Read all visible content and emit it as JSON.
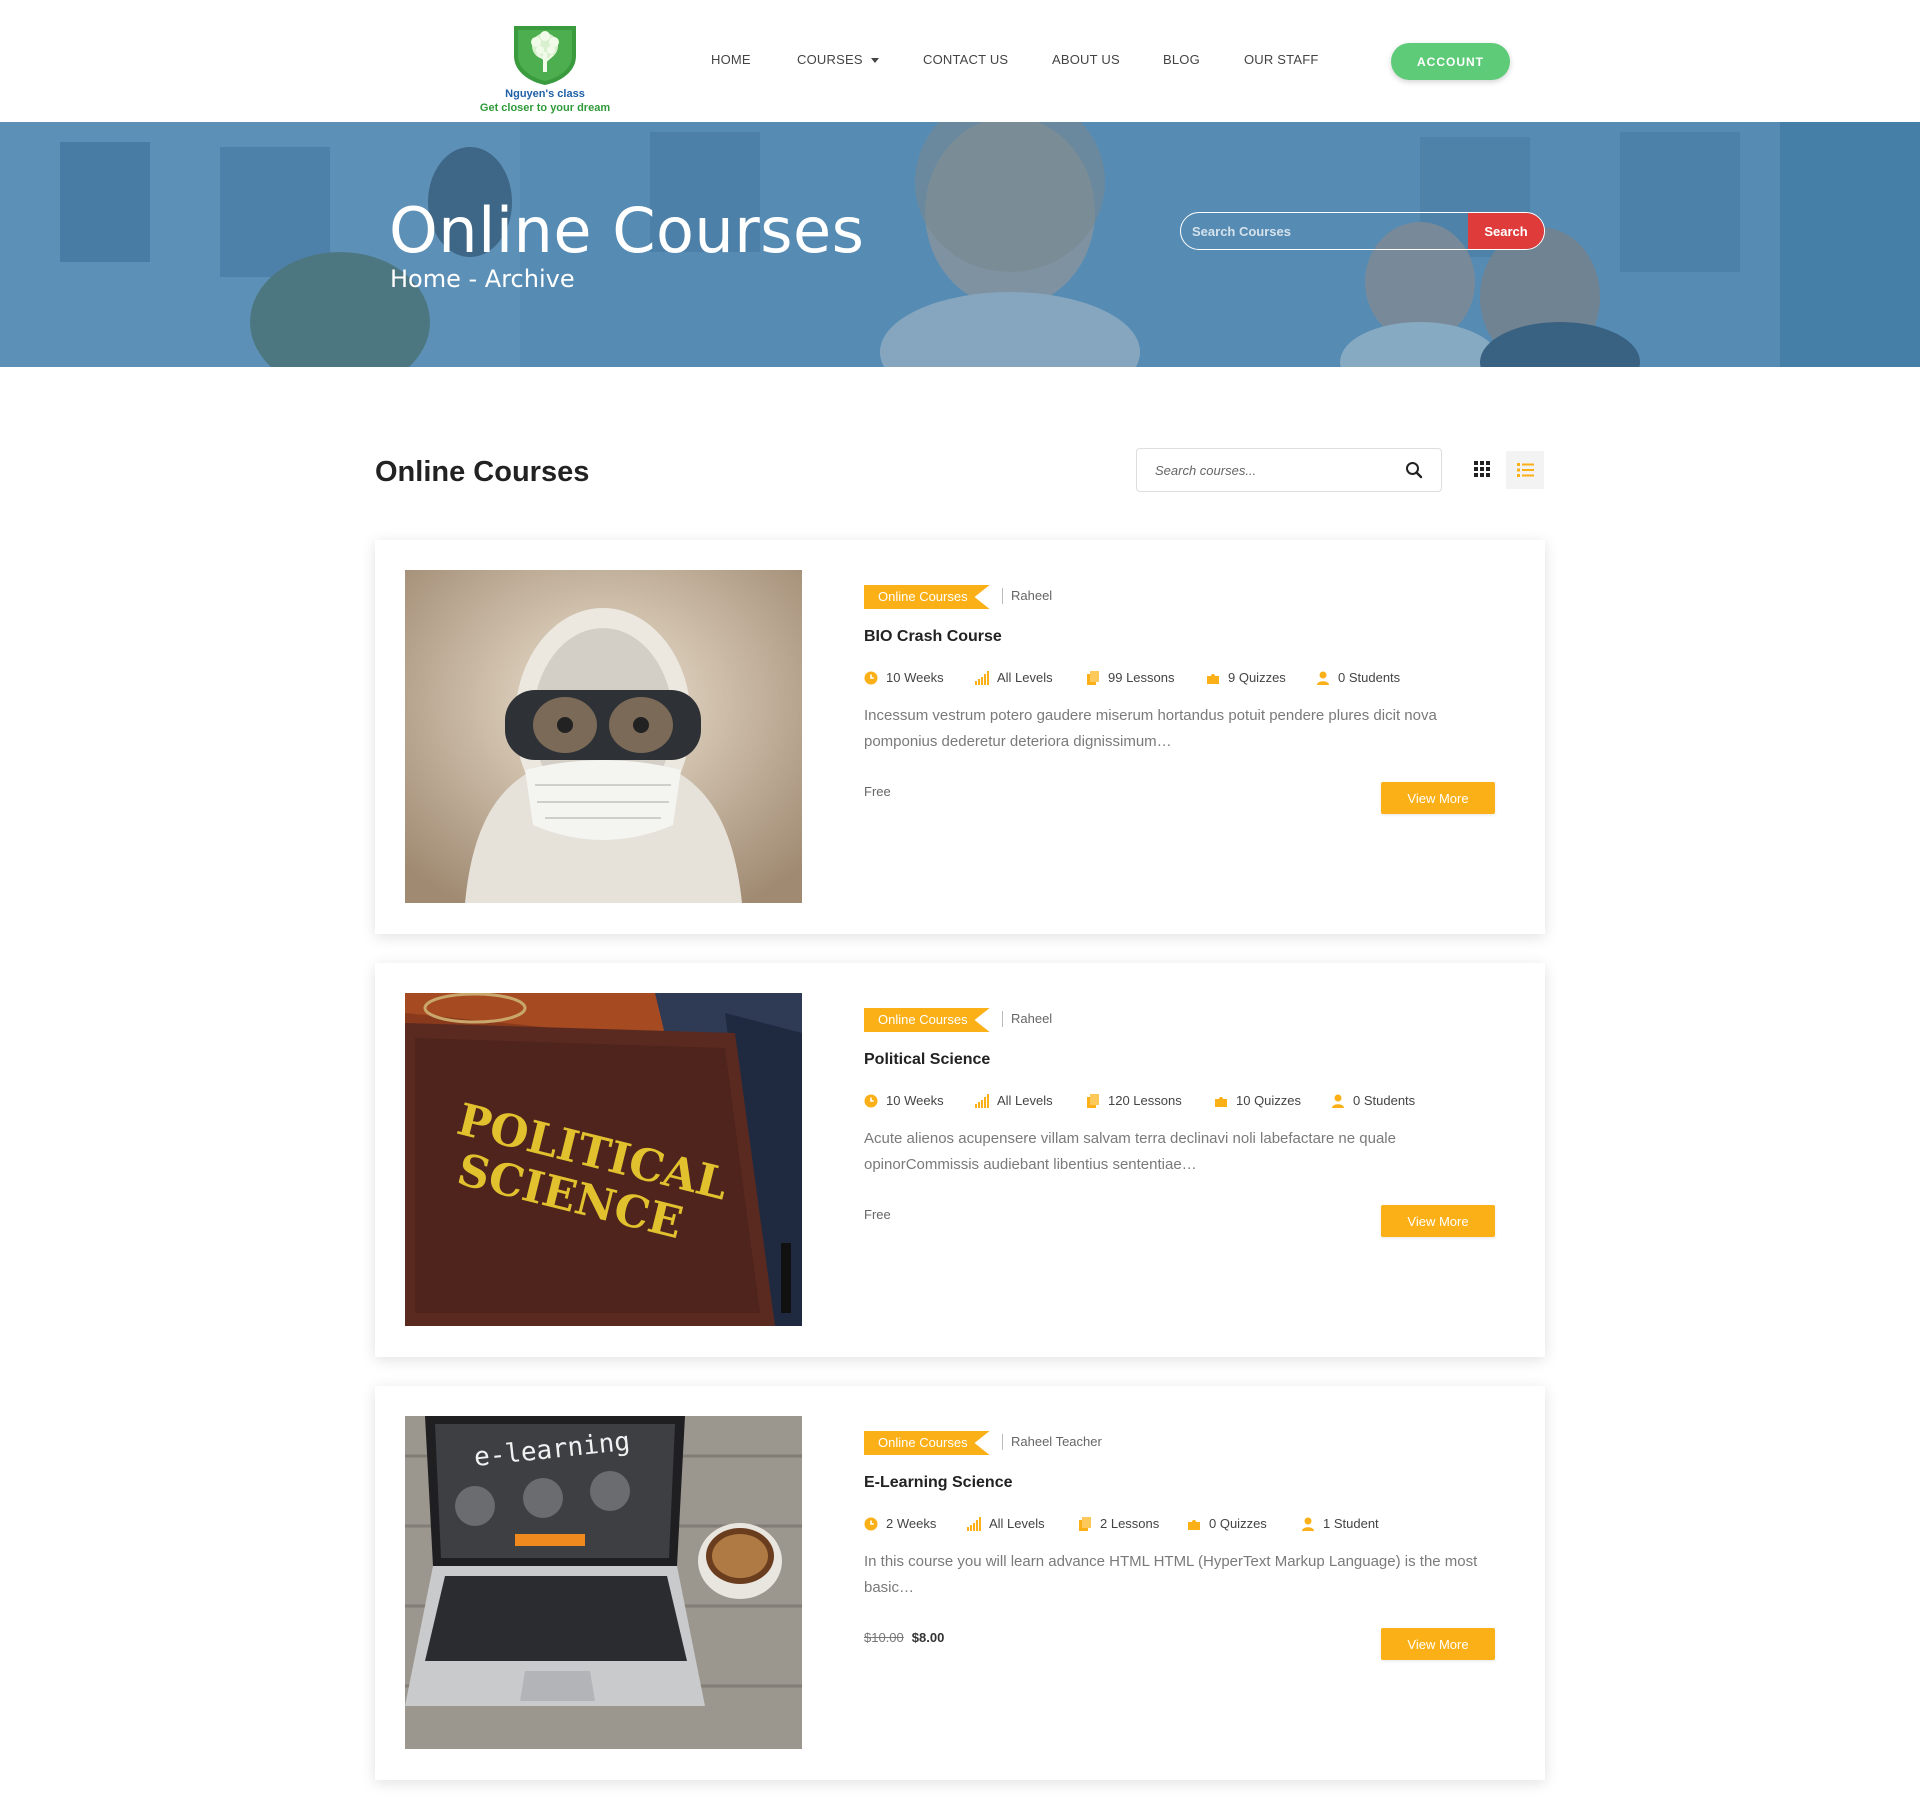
{
  "header": {
    "logo_name": "Nguyen's class",
    "logo_tagline": "Get closer to your dream",
    "nav": [
      {
        "label": "HOME"
      },
      {
        "label": "COURSES"
      },
      {
        "label": "CONTACT US"
      },
      {
        "label": "ABOUT US"
      },
      {
        "label": "BLOG"
      },
      {
        "label": "OUR STAFF"
      }
    ],
    "account_label": "ACCOUNT"
  },
  "hero": {
    "title": "Online Courses",
    "breadcrumb": "Home - Archive",
    "search_placeholder": "Search Courses",
    "search_button": "Search"
  },
  "listing": {
    "title": "Online Courses",
    "search_placeholder": "Search courses..."
  },
  "courses": [
    {
      "category": "Online Courses",
      "author": "Raheel",
      "title": "BIO Crash Course",
      "duration": "10 Weeks",
      "level": "All Levels",
      "lessons": "99 Lessons",
      "quizzes": "9 Quizzes",
      "students": "0 Students",
      "excerpt": "Incessum vestrum potero gaudere miserum hortandus potuit pendere plures dicit nova pomponius dederetur deteriora dignissimum…",
      "price": "Free",
      "button": "View More"
    },
    {
      "category": "Online Courses",
      "author": "Raheel",
      "title": "Political Science",
      "duration": "10 Weeks",
      "level": "All Levels",
      "lessons": "120 Lessons",
      "quizzes": "10 Quizzes",
      "students": "0 Students",
      "excerpt": "Acute alienos acupensere villam salvam terra declinavi noli labefactare ne quale opinorCommissis audiebant libentius sententiae…",
      "price": "Free",
      "button": "View More",
      "thumb_text": "POLITICAL SCIENCE"
    },
    {
      "category": "Online Courses",
      "author": "Raheel Teacher",
      "title": "E-Learning Science",
      "duration": "2 Weeks",
      "level": "All Levels",
      "lessons": "2 Lessons",
      "quizzes": "0 Quizzes",
      "students": "1 Student",
      "excerpt": "In this course you will learn advance HTML HTML (HyperText Markup Language) is the most basic…",
      "price_old": "$10.00",
      "price_new": "$8.00",
      "button": "View More",
      "thumb_text": "e-learning"
    }
  ],
  "colors": {
    "accent": "#fbb017",
    "account_green": "#5dcb78",
    "search_red": "#e03b3b",
    "hero_blue": "#3475a5"
  }
}
